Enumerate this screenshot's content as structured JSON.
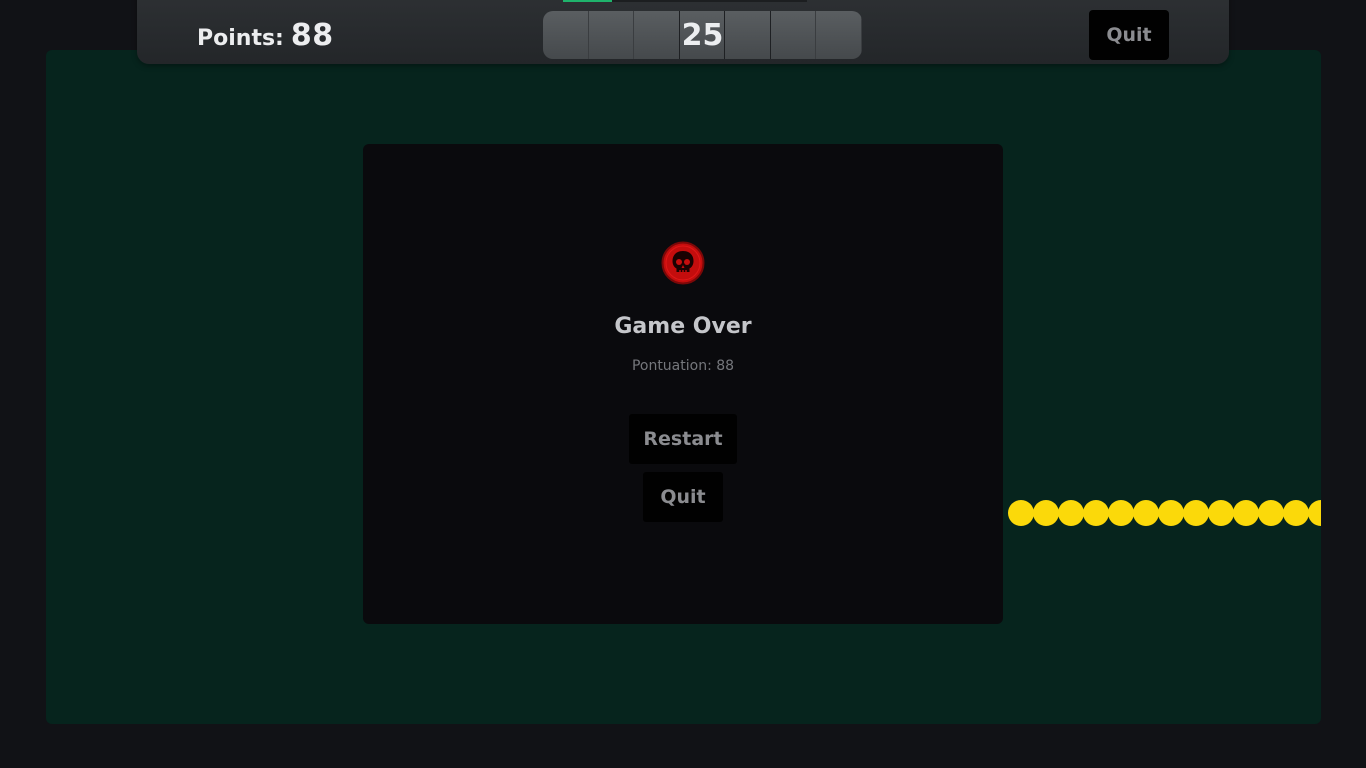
{
  "hud": {
    "points_label": "Points:",
    "points_value": "88",
    "timer_value": "25",
    "time_progress": 0.2,
    "quit_label": "Quit"
  },
  "game": {
    "snake_segments": 13,
    "snake_color": "#fbd90a",
    "field_color": "#06241d"
  },
  "modal": {
    "icon": "skull-icon",
    "title": "Game Over",
    "score_text": "Pontuation: 88",
    "restart_label": "Restart",
    "quit_label": "Quit"
  },
  "colors": {
    "accent_green": "#1fb36c",
    "danger_red": "#c40d0d",
    "background": "#111216"
  }
}
